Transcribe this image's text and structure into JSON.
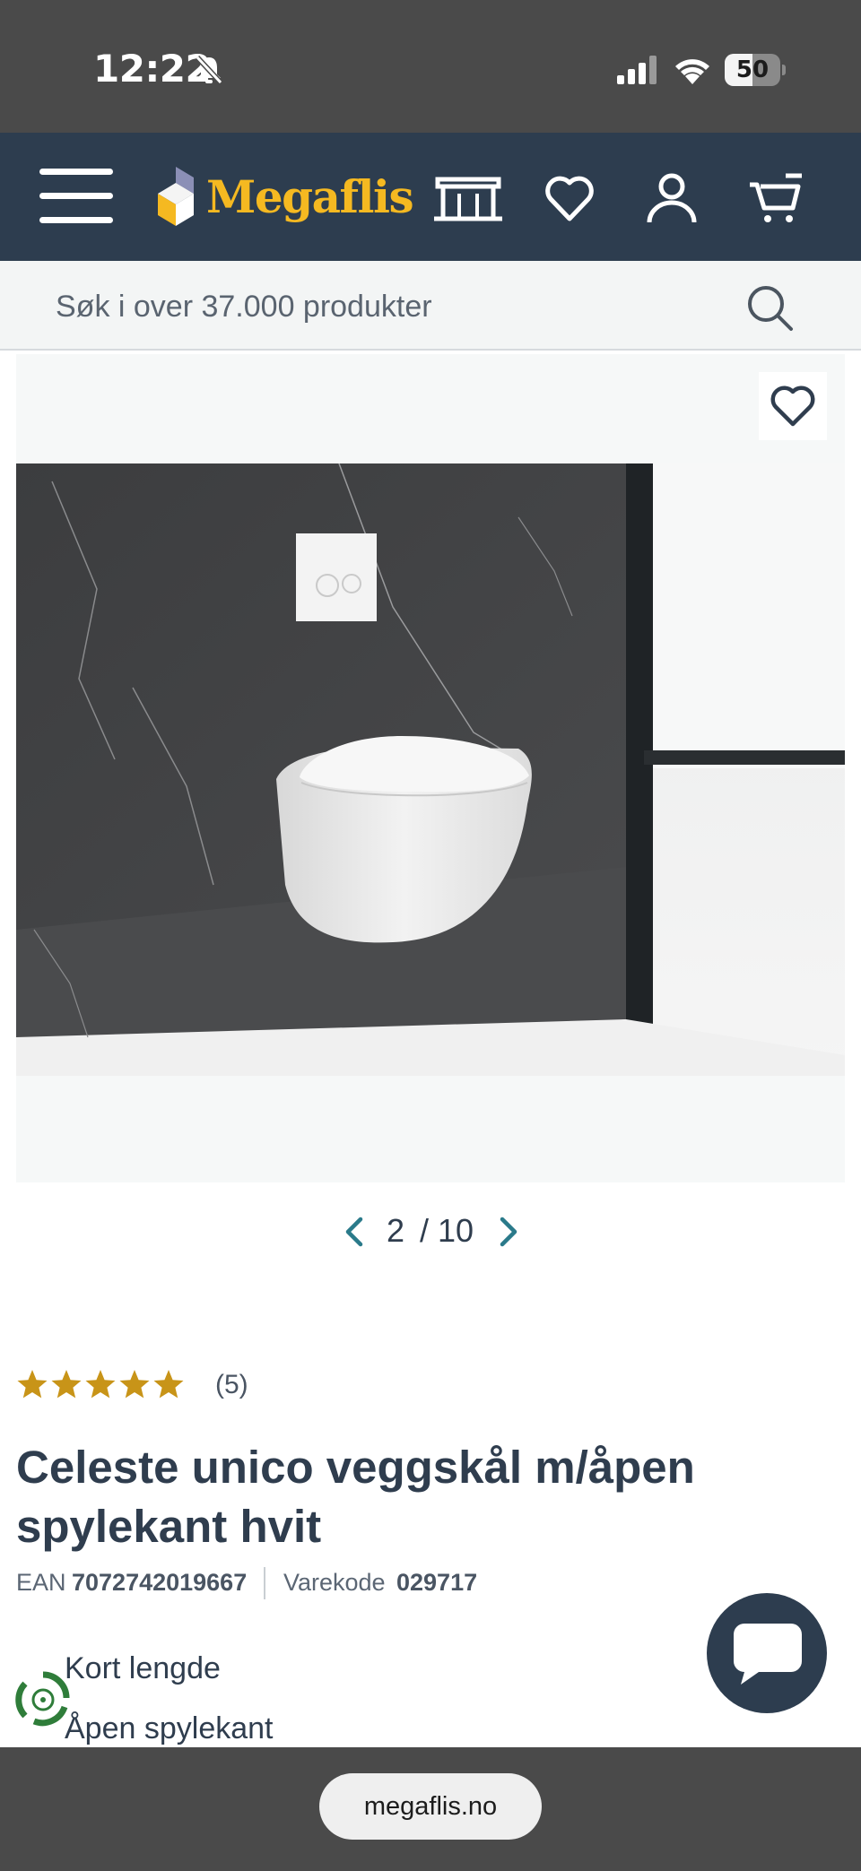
{
  "status_bar": {
    "time": "12:22",
    "battery": "50",
    "battery_level": 0.5
  },
  "header": {
    "logo_text": "Megaflis",
    "logo_color": "#f5b921",
    "background": "#2d3d4f",
    "icons": [
      "menu-icon",
      "store-icon",
      "heart-icon",
      "user-icon",
      "cart-icon"
    ]
  },
  "search": {
    "placeholder": "Søk i over 37.000 produkter",
    "icon": "search-icon"
  },
  "gallery": {
    "current": "2",
    "total": "/ 10",
    "favorite_icon": "heart-outline-icon"
  },
  "rating": {
    "stars": 5,
    "star_color": "#c89418",
    "count": "(5)"
  },
  "product": {
    "title": "Celeste unico veggskål m/åpen spylekant hvit",
    "ean_label": "EAN",
    "ean_value": "7072742019667",
    "code_label": "Varekode",
    "code_value": "029717",
    "features": [
      "Kort lengde",
      "Åpen spylekant"
    ]
  },
  "widgets": {
    "chat_icon": "chat-bubble-icon",
    "eco_icon": "eco-badge-icon"
  },
  "browser": {
    "url": "megaflis.no"
  }
}
